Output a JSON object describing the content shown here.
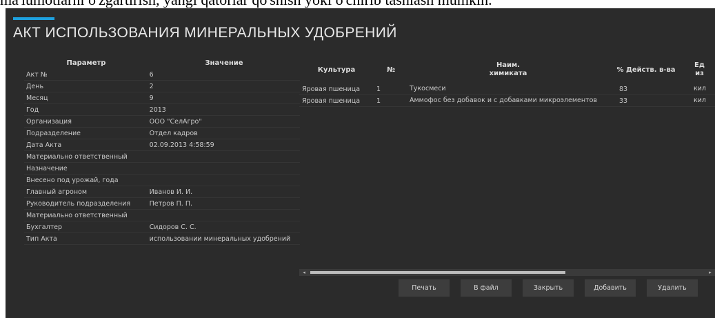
{
  "caption_text": "ma'lumotlarni o'zgartirish, yangi qatorlar qo'shish yoki o'chirib tashlash mumkin.",
  "window": {
    "title": "АКТ ИСПОЛЬЗОВАНИЯ МИНЕРАЛЬНЫХ УДОБРЕНИЙ",
    "accent_color": "#1ea1df",
    "background_color": "#2b2b2b"
  },
  "params": {
    "header_param": "Параметр",
    "header_value": "Значение",
    "rows": [
      {
        "label": "Акт №",
        "value": "6"
      },
      {
        "label": "День",
        "value": "2"
      },
      {
        "label": "Месяц",
        "value": "9"
      },
      {
        "label": "Год",
        "value": "2013"
      },
      {
        "label": "Организация",
        "value": "ООО \"СелАгро\""
      },
      {
        "label": "Подразделение",
        "value": "Отдел кадров"
      },
      {
        "label": "Дата Акта",
        "value": "02.09.2013 4:58:59"
      },
      {
        "label": "Материально ответственный",
        "value": ""
      },
      {
        "label": "Назначение",
        "value": ""
      },
      {
        "label": "Внесено под урожай, года",
        "value": ""
      },
      {
        "label": "Главный агроном",
        "value": "Иванов И. И."
      },
      {
        "label": "Руководитель подразделения",
        "value": "Петров П. П."
      },
      {
        "label": "Материально ответственный",
        "value": ""
      },
      {
        "label": "Бухгалтер",
        "value": "Сидоров С. С."
      },
      {
        "label": "Тип Акта",
        "value": "использовании минеральных удобрений"
      }
    ]
  },
  "grid": {
    "headers": {
      "culture": "Культура",
      "no": "№",
      "name_line1": "Наим.",
      "name_line2": "химиката",
      "pct": "% Действ. в-ва",
      "unit_line1": "Ед",
      "unit_line2": "из"
    },
    "rows": [
      {
        "culture": "Яровая пшеница",
        "no": "1",
        "name": "Тукосмеси",
        "pct": "83",
        "unit": "кил"
      },
      {
        "culture": "Яровая пшеница",
        "no": "1",
        "name": "Аммофос без добавок и с добавками микроэлементов",
        "pct": "33",
        "unit": "кил"
      }
    ]
  },
  "scrollbar": {
    "left_arrow": "◂",
    "right_arrow": "▸"
  },
  "buttons": {
    "print": "Печать",
    "to_file": "В файл",
    "close": "Закрыть",
    "add": "Добавить",
    "delete": "Удалить"
  }
}
